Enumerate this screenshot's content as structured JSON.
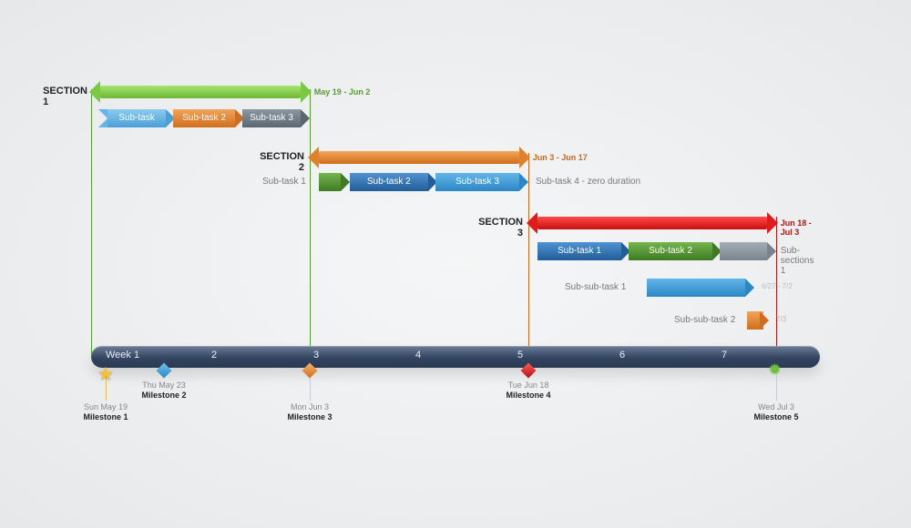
{
  "chart_data": {
    "type": "gantt",
    "title": "",
    "xlabel": "",
    "ylabel": "",
    "time_span": {
      "start": "Sun May 19",
      "end": "Wed Jul 3",
      "weeks": 7
    },
    "weeks": [
      "Week 1",
      "2",
      "3",
      "4",
      "5",
      "6",
      "7"
    ],
    "sections": [
      {
        "name": "SECTION 1",
        "date_range": "May 19 - Jun 2",
        "color": "#7ac943",
        "start_pct": 0,
        "end_pct": 30,
        "tasks": [
          {
            "name": "Sub-task",
            "color": "#66b5e6",
            "start_pct": 1,
            "end_pct": 11.5
          },
          {
            "name": "Sub-task 2",
            "color": "#e0812c",
            "start_pct": 10,
            "end_pct": 21
          },
          {
            "name": "Sub-task 3",
            "color": "#6f7d88",
            "start_pct": 19.5,
            "end_pct": 30
          }
        ]
      },
      {
        "name": "SECTION 2",
        "date_range": "Jun 3 - Jun 17",
        "color": "#e0812c",
        "start_pct": 30,
        "end_pct": 60,
        "tasks": [
          {
            "name": "Sub-task 1",
            "label_outside": true,
            "color": "#4e8a2f",
            "start_pct": 30,
            "end_pct": 35.5
          },
          {
            "name": "Sub-task 2",
            "color": "#2e72b6",
            "start_pct": 34.2,
            "end_pct": 47.5
          },
          {
            "name": "Sub-task 3",
            "color": "#3a9bd8",
            "start_pct": 46,
            "end_pct": 60
          },
          {
            "name": "Sub-task 4 - zero duration",
            "label_outside": true,
            "color": "#8a949c",
            "start_pct": 60,
            "end_pct": 60
          }
        ]
      },
      {
        "name": "SECTION 3",
        "date_range": "Jun 18 - Jul 3",
        "color": "#e11b1b",
        "start_pct": 60,
        "end_pct": 94,
        "tasks": [
          {
            "name": "Sub-task 1",
            "color": "#2e72b6",
            "start_pct": 60,
            "end_pct": 74
          },
          {
            "name": "Sub-task 2",
            "color": "#4e8a2f",
            "start_pct": 72.5,
            "end_pct": 86.5
          },
          {
            "name": "Sub-sections 1",
            "label_outside": true,
            "trailing": true,
            "color": "#8a949c",
            "start_pct": 85,
            "end_pct": 94
          }
        ],
        "sub_sub": [
          {
            "name": "Sub-sub-task 1",
            "date": "6/27 - 7/2",
            "color": "#3a9bd8",
            "start_pct": 75,
            "end_pct": 91
          },
          {
            "name": "Sub-sub-task 2",
            "date": "7/3",
            "color": "#e0812c",
            "start_pct": 90,
            "end_pct": 93
          }
        ]
      }
    ],
    "milestones": [
      {
        "name": "Milestone 1",
        "date": "Sun May 19",
        "shape": "star",
        "color": "#fbc02d",
        "pct": 2
      },
      {
        "name": "Milestone 2",
        "date": "Thu May 23",
        "shape": "diamond",
        "color": "#3a9bd8",
        "pct": 10
      },
      {
        "name": "Milestone 3",
        "date": "Mon Jun 3",
        "shape": "diamond",
        "color": "#e0812c",
        "pct": 30
      },
      {
        "name": "Milestone 4",
        "date": "Tue Jun 18",
        "shape": "diamond",
        "color": "#e11b1b",
        "pct": 60
      },
      {
        "name": "Milestone 5",
        "date": "Wed Jul 3",
        "shape": "burst",
        "color": "#6fbf3f",
        "pct": 94
      }
    ]
  }
}
